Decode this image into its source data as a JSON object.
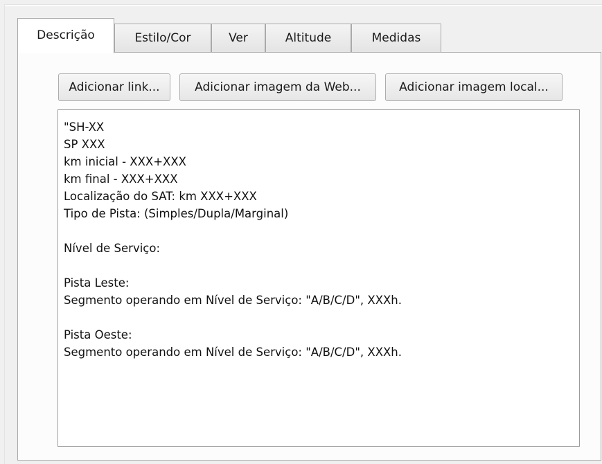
{
  "tabs": [
    {
      "label": "Descrição",
      "active": true
    },
    {
      "label": "Estilo/Cor",
      "active": false
    },
    {
      "label": "Ver",
      "active": false
    },
    {
      "label": "Altitude",
      "active": false
    },
    {
      "label": "Medidas",
      "active": false
    }
  ],
  "toolbar": {
    "add_link_label": "Adicionar link...",
    "add_web_image_label": "Adicionar imagem da Web...",
    "add_local_image_label": "Adicionar imagem local..."
  },
  "description": {
    "lines": [
      "\"SH-XX",
      "SP XXX",
      "km inicial - XXX+XXX",
      "km final - XXX+XXX",
      "Localização do SAT: km XXX+XXX",
      "Tipo de Pista: (Simples/Dupla/Marginal)",
      "",
      "Nível de Serviço:",
      "",
      "Pista Leste:",
      "Segmento operando em Nível de Serviço: \"A/B/C/D\", XXXh.",
      "",
      "Pista Oeste:",
      "Segmento operando em Nível de Serviço: \"A/B/C/D\", XXXh."
    ]
  }
}
